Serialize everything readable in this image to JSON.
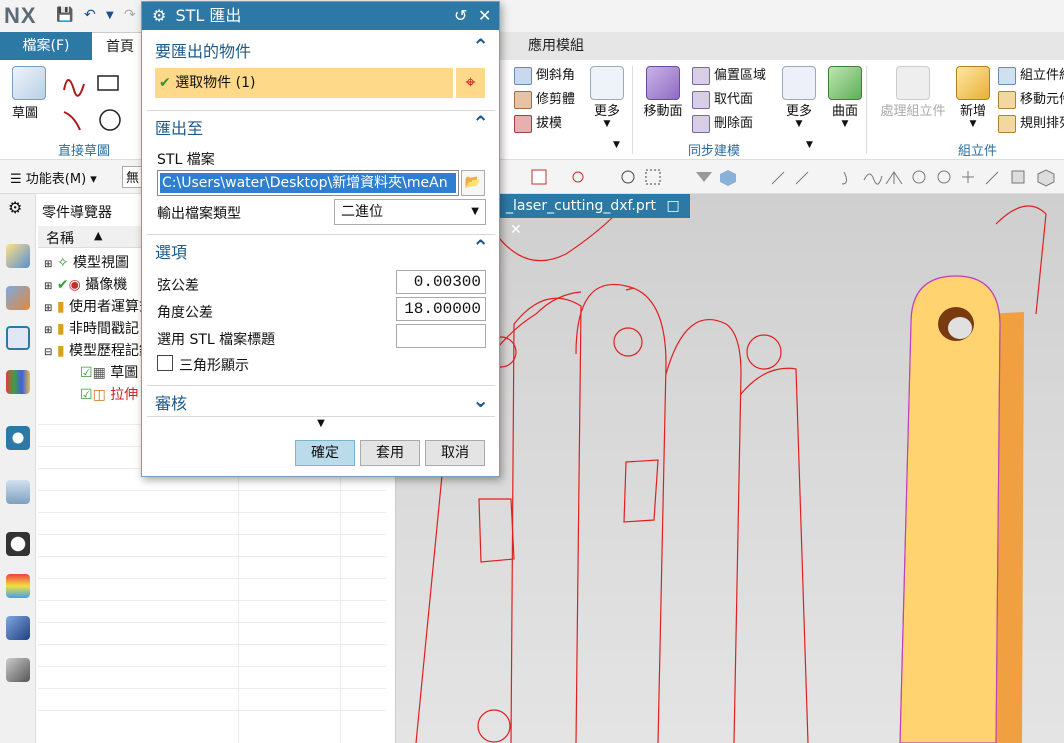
{
  "titlebar": {
    "logo": "NX"
  },
  "tabs": {
    "file": "檔案(F)",
    "home": "首頁",
    "app_modules": "應用模組"
  },
  "ribbon": {
    "sketch": "草圖",
    "direct_sketch": "直接草圖",
    "chamfer": "倒斜角",
    "trim_body": "修剪體",
    "draft": "拔模",
    "more1": "更多",
    "move_face": "移動面",
    "offset_region": "偏置區域",
    "replace_face": "取代面",
    "delete_face": "刪除面",
    "more2": "更多",
    "surface": "曲面",
    "sync_modeling": "同步建模",
    "process_assembly": "處理組立件",
    "new": "新增",
    "assembly_constraint": "組立件約",
    "move_component": "移動元件",
    "rule_arrange": "規則排列",
    "assemblies": "組立件"
  },
  "cmdbar": {
    "menu": "功能表(M)",
    "filter": "無"
  },
  "navigator": {
    "title": "零件導覽器",
    "column_name": "名稱",
    "items": [
      {
        "label": "模型視圖"
      },
      {
        "label": "攝像機"
      },
      {
        "label": "使用者運算式"
      },
      {
        "label": "非時間戳記"
      },
      {
        "label": "模型歷程記錄"
      },
      {
        "label": "草圖"
      },
      {
        "label": "拉伸"
      }
    ]
  },
  "document_tab": {
    "title": "_laser_cutting_dxf.prt"
  },
  "dialog": {
    "title": "STL 匯出",
    "objects_section": "要匯出的物件",
    "select_objects": "選取物件 (1)",
    "export_to_section": "匯出至",
    "stl_file_label": "STL 檔案",
    "stl_file_path": "C:\\Users\\water\\Desktop\\新增資料夾\\meAn",
    "output_type_label": "輸出檔案類型",
    "output_type_value": "二進位",
    "options_section": "選項",
    "chord_tol_label": "弦公差",
    "chord_tol_value": "0.00300",
    "angle_tol_label": "角度公差",
    "angle_tol_value": "18.00000",
    "use_header_label": "選用 STL 檔案標題",
    "header_value": "",
    "triangle_display_label": "三角形顯示",
    "review_section": "審核",
    "ok": "確定",
    "apply": "套用",
    "cancel": "取消"
  },
  "colors": {
    "accent": "#2d79a6",
    "highlight": "#ffd98a",
    "part": "#ffd470",
    "sketch_line": "#e02020"
  }
}
